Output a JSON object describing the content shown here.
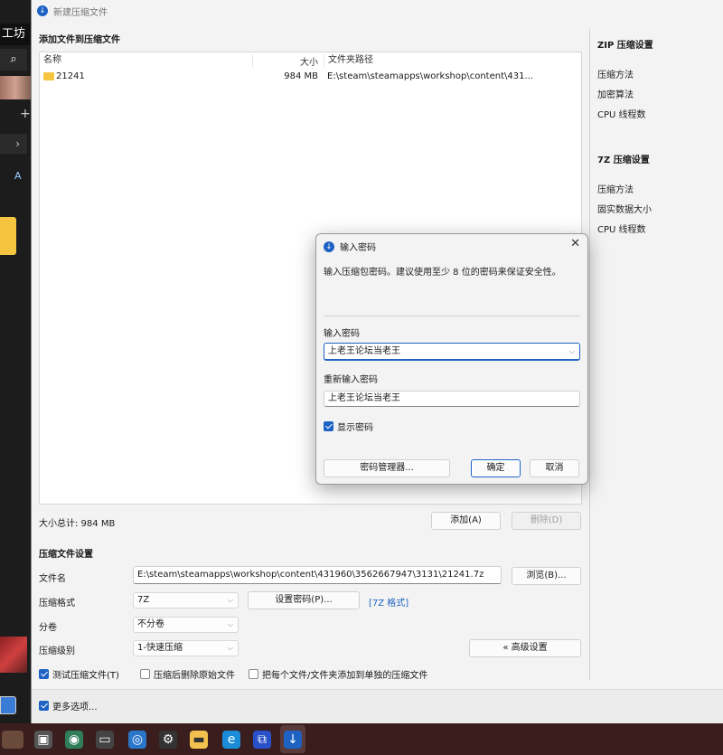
{
  "background_app": {
    "title_fragment": "工坊",
    "search_icon": "search-icon"
  },
  "window": {
    "title": "新建压缩文件"
  },
  "files": {
    "section_title": "添加文件到压缩文件",
    "columns": {
      "name": "名称",
      "size": "大小",
      "path": "文件夹路径"
    },
    "rows": [
      {
        "name": "21241",
        "size": "984 MB",
        "path": "E:\\steam\\steamapps\\workshop\\content\\431..."
      }
    ],
    "total_label": "大小总计: 984 MB",
    "add_button": "添加(A)",
    "delete_button": "删除(D)"
  },
  "sidebar": {
    "zip_header": "ZIP 压缩设置",
    "zip_items": [
      "压缩方法",
      "加密算法",
      "CPU 线程数"
    ],
    "sevenz_header": "7Z 压缩设置",
    "sevenz_items": [
      "压缩方法",
      "固实数据大小",
      "CPU 线程数"
    ]
  },
  "settings": {
    "section_title": "压缩文件设置",
    "filename_label": "文件名",
    "filename_value": "E:\\steam\\steamapps\\workshop\\content\\431960\\3562667947\\3131\\21241.7z",
    "browse_button": "浏览(B)...",
    "format_label": "压缩格式",
    "format_value": "7Z",
    "set_password_button": "设置密码(P)...",
    "format_link": "[7Z 格式]",
    "split_label": "分卷",
    "split_value": "不分卷",
    "level_label": "压缩级别",
    "level_value": "1-快速压缩",
    "advanced_button": "« 高级设置",
    "test_check": "测试压缩文件(T)",
    "delete_after_check": "压缩后删除原始文件",
    "each_separate_check": "把每个文件/文件夹添加到单独的压缩文件",
    "more_options_check": "更多选项..."
  },
  "dialog": {
    "title": "输入密码",
    "message": "输入压缩包密码。建议使用至少 8 位的密码来保证安全性。",
    "password_label": "输入密码",
    "password_value": "上老王论坛当老王",
    "confirm_label": "重新输入密码",
    "confirm_value": "上老王论坛当老王",
    "show_password": "显示密码",
    "manager_button": "密码管理器...",
    "ok_button": "确定",
    "cancel_button": "取消"
  },
  "colors": {
    "accent": "#1e63c4",
    "folder": "#f5c542",
    "taskbar": "#3a1e1e"
  }
}
